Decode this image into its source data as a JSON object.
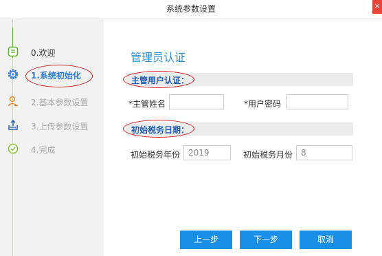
{
  "window": {
    "title": "系统参数设置",
    "close_label": "×"
  },
  "steps": [
    {
      "label": "0.欢迎",
      "state": "done",
      "icon": "list-icon"
    },
    {
      "label": "1.系统初始化",
      "state": "active",
      "icon": "gear-icon"
    },
    {
      "label": "2.基本参数设置",
      "state": "pending",
      "icon": "user-icon"
    },
    {
      "label": "3.上传参数设置",
      "state": "pending",
      "icon": "upload-icon"
    },
    {
      "label": "4.完成",
      "state": "pending",
      "icon": "check-circle-icon"
    }
  ],
  "main": {
    "title": "管理员认证",
    "section_admin": "主管用户认证：",
    "admin_name_label": "*主管姓名",
    "admin_name_value": "",
    "admin_password_label": "*用户密码",
    "admin_password_value": "",
    "section_tax_date": "初始税务日期：",
    "tax_year_label": "初始税务年份",
    "tax_year_value": "2019",
    "tax_month_label": "初始税务月份",
    "tax_month_value": "8"
  },
  "buttons": {
    "prev": "上一步",
    "next": "下一步",
    "cancel": "取消"
  },
  "colors": {
    "accent": "#1a8fe8",
    "active_step": "#2d7bd6",
    "done_icon": "#5fb82b",
    "annotation": "#d62020"
  }
}
